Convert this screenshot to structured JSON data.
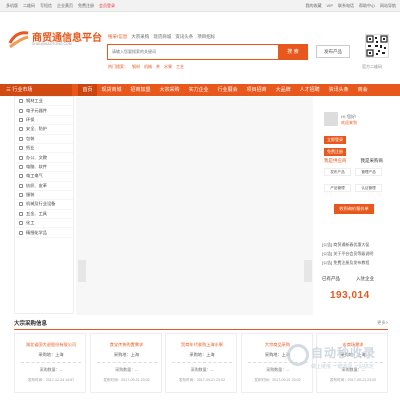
{
  "topbar": {
    "left": [
      "多机版",
      "二维码",
      "写短信",
      "企业黄页",
      "免费注册",
      "会员登录"
    ],
    "right": [
      "我的收藏",
      "VIP",
      "联系电话",
      "帮助中心",
      "网站导航"
    ]
  },
  "logo": {
    "title": "商贸通信息平台",
    "subtitle": "SHANGMAOTONG.COM"
  },
  "search": {
    "tabs": [
      "搜采/信息",
      "大宗采购",
      "现货商城",
      "资讯头条",
      "项目招标"
    ],
    "placeholder": "请输入您要搜索的关键词",
    "button": "搜 索",
    "publish": "发布产品",
    "hot_label": "热门搜索：",
    "hot": [
      "钢材",
      "机械",
      "茶",
      "水果",
      "工艺"
    ]
  },
  "qr_label": "官方二维码",
  "nav": {
    "category": "三 行业市场",
    "items": [
      "首页",
      "现货商城",
      "招商加盟",
      "大宗采购",
      "实力企业",
      "行业展会",
      "项目招商",
      "大品牌",
      "人才招聘",
      "资讯头条",
      "商会"
    ]
  },
  "sidebar": [
    "钢材工业",
    "电子元器件",
    "环保",
    "安全、防护",
    "包装",
    "纸业",
    "办公、文教",
    "电脑、软件",
    "电工电气",
    "纺织、皮革",
    "服装",
    "机械及行业设备",
    "五金、工具",
    "化工",
    "精细化学品"
  ],
  "user": {
    "greeting": "Hi, 您好!",
    "welcome": "欢迎来到",
    "login": "立即登录",
    "register": "免费注册",
    "tab_a": "我是供应商",
    "tab_b": "我是采购商",
    "grid": [
      "发布产品",
      "管理产品",
      "产品管理",
      "认证管理"
    ],
    "cta": "收到询价报价单"
  },
  "notices": [
    "[公告] 商贸通新春优惠大促",
    "[公告] 关于平台会员等级说明",
    "[公告] 免费注册及发布教程"
  ],
  "stats": {
    "left": "已有产品",
    "right": "入驻企业",
    "count": "193,014"
  },
  "section": {
    "title": "大宗采购信息",
    "more": "更多>"
  },
  "cards": [
    {
      "title": "湖北省国大退股份有限公司",
      "place": "采购地：上海",
      "qty": "采购数量：--",
      "date": "发布时间：2017-12-24 14:57"
    },
    {
      "title": "食宝传快购置需求",
      "place": "采购地：上海",
      "qty": "采购数量：--",
      "date": "发布时间：2017-09-21 23:02"
    },
    {
      "title": "贸商年代收购上海水果",
      "place": "采购地：上海",
      "qty": "采购数量：--",
      "date": "发布时间：2017-09-21 23:02"
    },
    {
      "title": "大宗商品采购",
      "place": "采购地：上海",
      "qty": "采购数量：--",
      "date": "发布时间：2017-09-21 23:02"
    },
    {
      "title": "宏商场需求",
      "place": "采购地：上海",
      "qty": "采购数量：--",
      "date": "发布时间：2017-09-21 23:02"
    }
  ],
  "watermark": {
    "title": "自动秒收录",
    "sub": "做上链接 一键收录 一站搞定"
  },
  "colors": {
    "brand": "#e8581d"
  }
}
